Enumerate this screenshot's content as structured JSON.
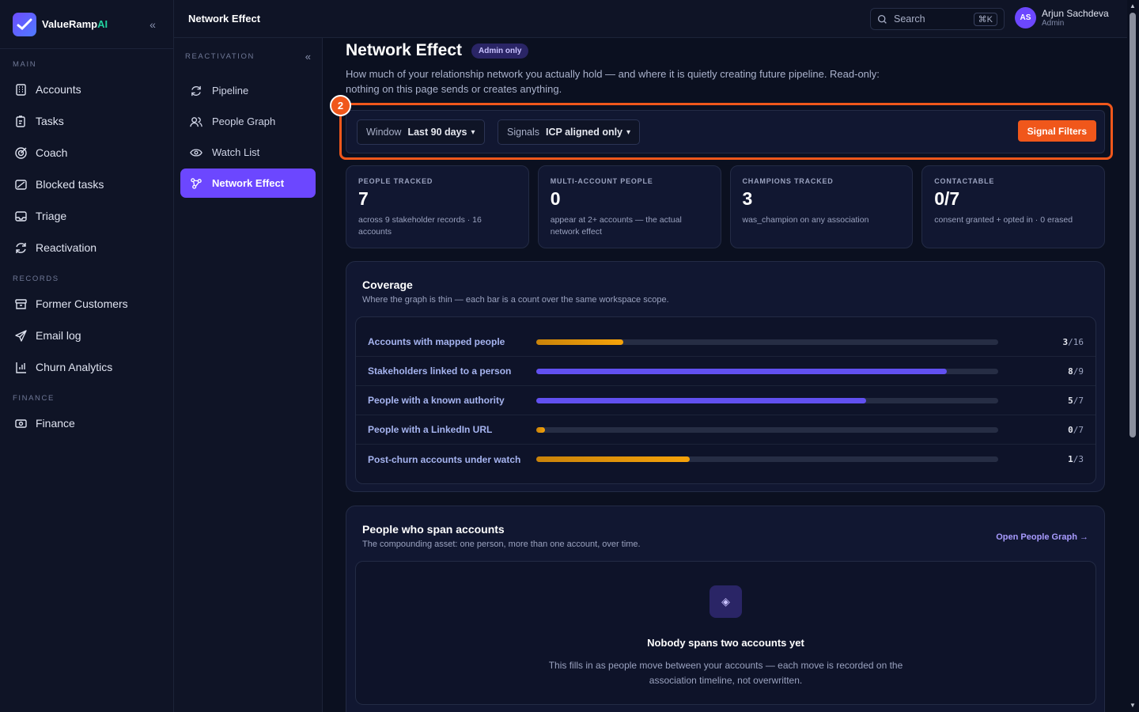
{
  "brand": {
    "name": "ValueRamp",
    "suffix": "AI"
  },
  "sidebar": {
    "sections": [
      {
        "label": "MAIN",
        "items": [
          {
            "label": "Accounts",
            "icon": "building-icon"
          },
          {
            "label": "Tasks",
            "icon": "clipboard-icon"
          },
          {
            "label": "Coach",
            "icon": "target-icon"
          },
          {
            "label": "Blocked tasks",
            "icon": "blocked-icon"
          },
          {
            "label": "Triage",
            "icon": "inbox-icon"
          },
          {
            "label": "Reactivation",
            "icon": "refresh-icon"
          }
        ]
      },
      {
        "label": "RECORDS",
        "items": [
          {
            "label": "Former Customers",
            "icon": "archive-icon"
          },
          {
            "label": "Email log",
            "icon": "send-icon"
          },
          {
            "label": "Churn Analytics",
            "icon": "chart-icon"
          }
        ]
      },
      {
        "label": "FINANCE",
        "items": [
          {
            "label": "Finance",
            "icon": "cash-icon"
          }
        ]
      }
    ]
  },
  "subnav": {
    "label": "REACTIVATION",
    "items": [
      {
        "label": "Pipeline",
        "icon": "refresh-icon",
        "active": false
      },
      {
        "label": "People Graph",
        "icon": "users-icon",
        "active": false
      },
      {
        "label": "Watch List",
        "icon": "eye-icon",
        "active": false
      },
      {
        "label": "Network Effect",
        "icon": "network-icon",
        "active": true
      }
    ]
  },
  "topbar": {
    "title": "Network Effect",
    "search_placeholder": "Search",
    "shortcut": "⌘K",
    "user": {
      "initials": "AS",
      "name": "Arjun Sachdeva",
      "role": "Admin"
    }
  },
  "page": {
    "title": "Network Effect",
    "badge": "Admin only",
    "description": "How much of your relationship network you actually hold — and where it is quietly creating future pipeline. Read-only: nothing on this page sends or creates anything.",
    "step_number": "2"
  },
  "filters": {
    "window": {
      "key": "Window",
      "value": "Last 90 days"
    },
    "signals": {
      "key": "Signals",
      "value": "ICP aligned only"
    },
    "button": "Signal Filters"
  },
  "stats": [
    {
      "label": "PEOPLE TRACKED",
      "value": "7",
      "sub": "across 9 stakeholder records · 16 accounts"
    },
    {
      "label": "MULTI-ACCOUNT PEOPLE",
      "value": "0",
      "sub": "appear at 2+ accounts — the actual network effect"
    },
    {
      "label": "CHAMPIONS TRACKED",
      "value": "3",
      "sub": "was_champion on any association"
    },
    {
      "label": "CONTACTABLE",
      "value": "0/7",
      "sub": "consent granted + opted in · 0 erased"
    }
  ],
  "coverage": {
    "title": "Coverage",
    "subtitle": "Where the graph is thin — each bar is a count over the same workspace scope.",
    "rows": [
      {
        "label": "Accounts with mapped people",
        "num": "3",
        "den": "/16",
        "fraction": 0.1875,
        "color": "orange"
      },
      {
        "label": "Stakeholders linked to a person",
        "num": "8",
        "den": "/9",
        "fraction": 0.889,
        "color": "violet"
      },
      {
        "label": "People with a known authority",
        "num": "5",
        "den": "/7",
        "fraction": 0.714,
        "color": "violet"
      },
      {
        "label": "People with a LinkedIn URL",
        "num": "0",
        "den": "/7",
        "fraction": 0.0,
        "color": "orange"
      },
      {
        "label": "Post-churn accounts under watch",
        "num": "1",
        "den": "/3",
        "fraction": 0.333,
        "color": "orange"
      }
    ]
  },
  "span": {
    "title": "People who span accounts",
    "subtitle": "The compounding asset: one person, more than one account, over time.",
    "link": "Open People Graph →",
    "empty_title": "Nobody spans two accounts yet",
    "empty_desc": "This fills in as people move between your accounts — each move is recorded on the association timeline, not overwritten."
  },
  "colors": {
    "accent": "#6c47ff",
    "orange": "#f0571b",
    "bar_orange": "#f5a20a",
    "bar_violet": "#6150f0"
  }
}
